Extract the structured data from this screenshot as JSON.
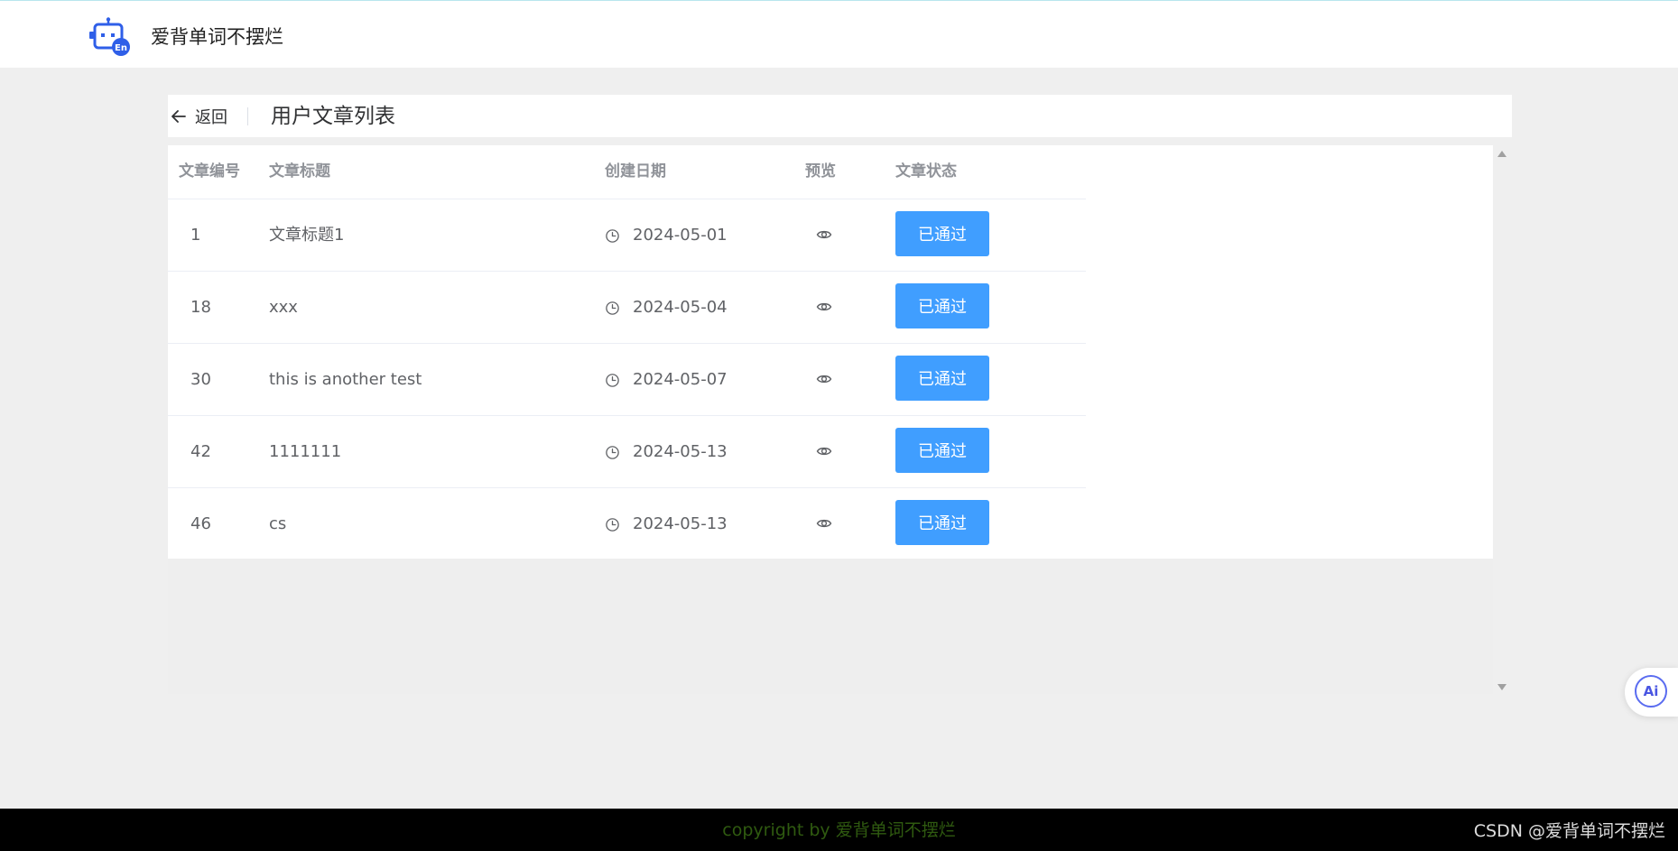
{
  "header": {
    "app_title": "爱背单词不摆烂",
    "logo_icon": "robot-en-icon",
    "accent_color": "#3f6df5"
  },
  "page": {
    "back_label": "返回",
    "title": "用户文章列表"
  },
  "table": {
    "columns": {
      "id": "文章编号",
      "title": "文章标题",
      "date": "创建日期",
      "preview": "预览",
      "status": "文章状态"
    },
    "rows": [
      {
        "id": "1",
        "title": "文章标题1",
        "date": "2024-05-01",
        "status": "已通过"
      },
      {
        "id": "18",
        "title": "xxx",
        "date": "2024-05-04",
        "status": "已通过"
      },
      {
        "id": "30",
        "title": "this is another test",
        "date": "2024-05-07",
        "status": "已通过"
      },
      {
        "id": "42",
        "title": "1111111",
        "date": "2024-05-13",
        "status": "已通过"
      },
      {
        "id": "46",
        "title": "cs",
        "date": "2024-05-13",
        "status": "已通过"
      }
    ],
    "status_color": "#409eff",
    "date_icon": "clock-icon",
    "preview_icon": "eye-icon"
  },
  "ai_button": {
    "label": "Ai"
  },
  "footer": {
    "copyright": "copyright by 爱背单词不摆烂",
    "watermark": "CSDN @爱背单词不摆烂"
  }
}
